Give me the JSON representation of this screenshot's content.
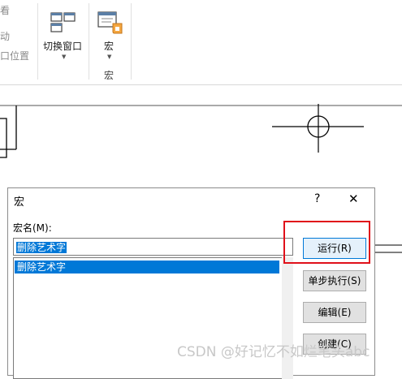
{
  "ribbon": {
    "partial_items": [
      "看",
      "动",
      "口位置"
    ],
    "switch_window": {
      "label": "切换窗口",
      "icon": "windows-icon"
    },
    "macro": {
      "label": "宏",
      "icon": "macro-icon",
      "group_label": "宏"
    }
  },
  "dialog": {
    "title": "宏",
    "help": "?",
    "close": "✕",
    "macro_name_label": "宏名(M):",
    "macro_name_value": "删除艺术字",
    "macros": [
      "删除艺术字"
    ],
    "buttons": {
      "run": "运行(R)",
      "step": "单步执行(S)",
      "edit": "编辑(E)",
      "create": "创建(C)"
    }
  },
  "watermark": "CSDN @好记忆不如烂笔头abc"
}
